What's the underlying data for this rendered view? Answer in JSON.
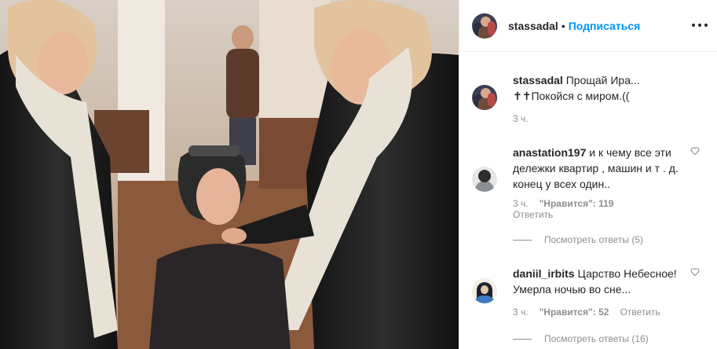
{
  "header": {
    "username": "stassadal",
    "separator": "•",
    "follow_label": "Подписаться",
    "more_icon": "more-horizontal-icon"
  },
  "caption": {
    "username": "stassadal",
    "text": "Прощай Ира... ✝✝Покойся с миром.((",
    "time": "3 ч."
  },
  "comments": [
    {
      "username": "anastation197",
      "text": "и к чему все эти дележки квартир , машин и т . д. конец у всех один..",
      "time": "3 ч.",
      "likes": "\"Нравится\": 119",
      "reply_label": "Ответить",
      "view_replies": "Посмотреть ответы (5)"
    },
    {
      "username": "daniil_irbits",
      "text": "Царство Небесное! Умерла ночью во сне...",
      "time": "3 ч.",
      "likes": "\"Нравится\": 52",
      "reply_label": "Ответить",
      "view_replies": "Посмотреть ответы (16)"
    }
  ],
  "colors": {
    "accent": "#0095f6",
    "text": "#262626",
    "muted": "#8e8e8e",
    "divider": "#efefef"
  }
}
